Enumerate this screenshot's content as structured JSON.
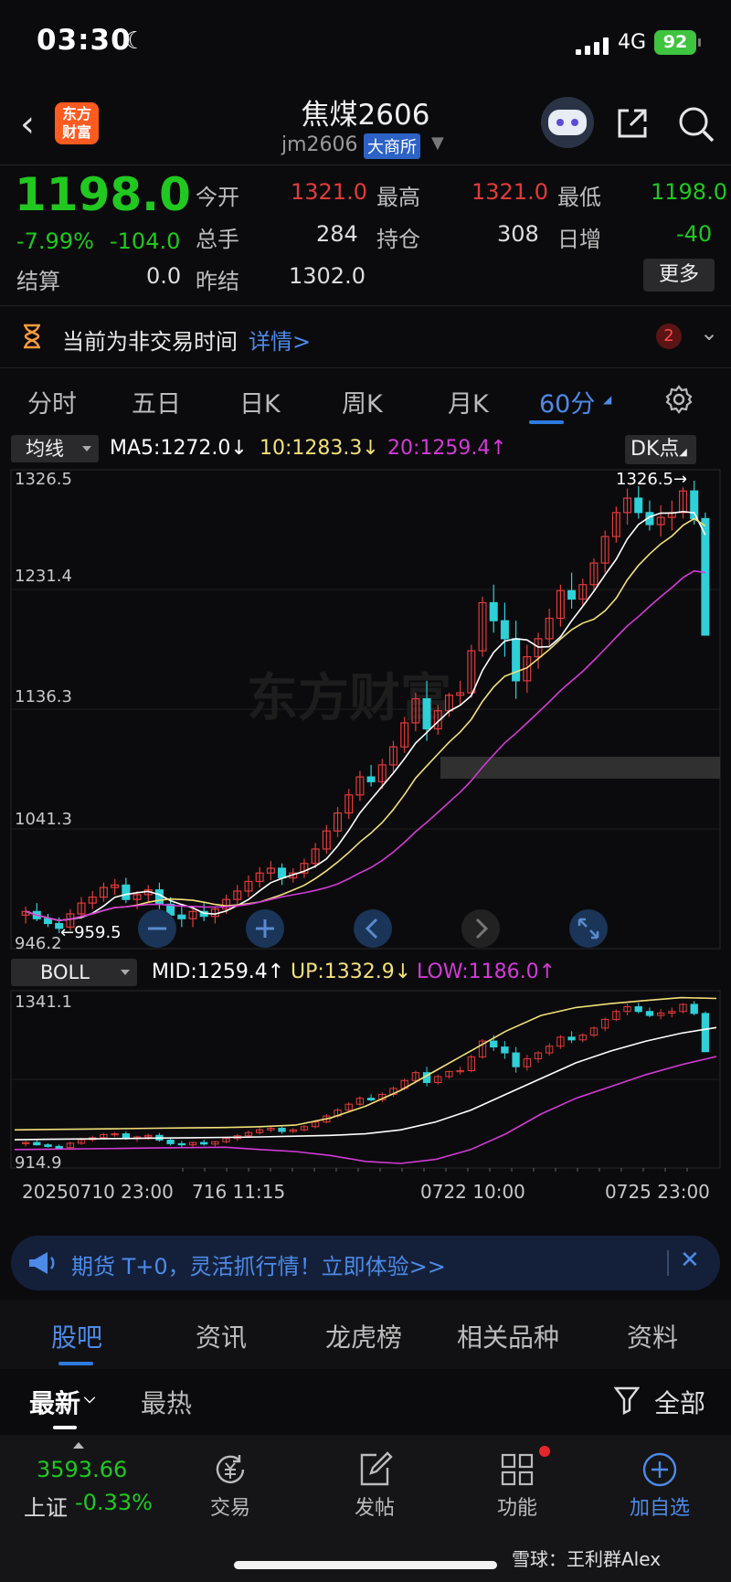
{
  "status_bar": {
    "time": "03:30",
    "moon": "☾",
    "network": "4G",
    "battery": "92"
  },
  "header": {
    "logo_text_1": "东方",
    "logo_text_2": "财富",
    "title": "焦煤2606",
    "code": "jm2606",
    "exchange": "大商所"
  },
  "quote": {
    "price": "1198.0",
    "change_pct": "-7.99%",
    "change_abs": "-104.0",
    "open_label": "今开",
    "open": "1321.0",
    "high_label": "最高",
    "high": "1321.0",
    "low_label": "最低",
    "low": "1198.0",
    "volume_label": "总手",
    "volume": "284",
    "oi_label": "持仓",
    "oi": "308",
    "daily_inc_label": "日增",
    "daily_inc": "-40",
    "settle_label": "结算",
    "settle": "0.0",
    "prev_settle_label": "昨结",
    "prev_settle": "1302.0",
    "more_label": "更多"
  },
  "notice": {
    "text": "当前为非交易时间",
    "link": "详情>",
    "badge": "2"
  },
  "period_tabs": [
    "分时",
    "五日",
    "日K",
    "周K",
    "月K",
    "60分"
  ],
  "period_active_caret": "◢",
  "main_chart": {
    "ma_selector": "均线",
    "ma5": "MA5:1272.0↓",
    "ma10": "10:1283.3↓",
    "ma20": "20:1259.4↑",
    "dk_button": "DK点",
    "dk_caret": "◢",
    "y_labels": [
      "1326.5",
      "1231.4",
      "1136.3",
      "1041.3",
      "946.2"
    ],
    "high_marker": "1326.5→",
    "low_marker": "←959.5",
    "watermark": "东方财富"
  },
  "boll_chart": {
    "selector": "BOLL",
    "mid": "MID:1259.4↑",
    "up": "UP:1332.9↓",
    "low": "LOW:1186.0↑",
    "y_labels": [
      "1341.1",
      "914.9"
    ]
  },
  "x_labels": [
    "20250710 23:00",
    "716 11:15",
    "0722 10:00",
    "0725 23:00"
  ],
  "colors": {
    "up": "#e23b3b",
    "down": "#2fd0d8",
    "ma5": "#ffffff",
    "ma10": "#f3e07a",
    "ma20": "#d23bd6",
    "accent": "#4d8ae8",
    "green": "#20c820"
  },
  "banner": {
    "text": "期货 T+0，灵活抓行情！立即体验>>"
  },
  "content_tabs": [
    "股吧",
    "资讯",
    "龙虎榜",
    "相关品种",
    "资料"
  ],
  "sort_tabs": {
    "latest": "最新",
    "hottest": "最热",
    "filter": "全部"
  },
  "bottom_bar": {
    "index_value": "3593.66",
    "index_name": "上证",
    "index_change": "-0.33%",
    "trade": "交易",
    "post": "发帖",
    "functions": "功能",
    "add_watch": "加自选"
  },
  "watermark": {
    "text": "雪球：王利群Alex"
  },
  "chart_data": [
    {
      "type": "candlestick",
      "title": "",
      "xlabel": "",
      "ylabel": "",
      "x": [
        "20250710 23:00",
        "716 11:15",
        "0722 10:00",
        "0725 23:00"
      ],
      "ylim": [
        946.2,
        1326.5
      ],
      "ohlc": [
        [
          965,
          972,
          958,
          968
        ],
        [
          968,
          975,
          960,
          962
        ],
        [
          962,
          966,
          955,
          958
        ],
        [
          958,
          963,
          950,
          954
        ],
        [
          955,
          970,
          952,
          966
        ],
        [
          966,
          980,
          962,
          975
        ],
        [
          975,
          985,
          970,
          980
        ],
        [
          980,
          992,
          976,
          988
        ],
        [
          988,
          995,
          982,
          990
        ],
        [
          990,
          996,
          975,
          978
        ],
        [
          978,
          985,
          970,
          982
        ],
        [
          982,
          990,
          975,
          986
        ],
        [
          986,
          992,
          970,
          974
        ],
        [
          974,
          980,
          960,
          965
        ],
        [
          965,
          972,
          955,
          962
        ],
        [
          962,
          970,
          955,
          968
        ],
        [
          968,
          975,
          960,
          964
        ],
        [
          964,
          972,
          958,
          970
        ],
        [
          970,
          982,
          966,
          978
        ],
        [
          978,
          990,
          972,
          985
        ],
        [
          985,
          998,
          980,
          993
        ],
        [
          993,
          1005,
          988,
          1000
        ],
        [
          1000,
          1010,
          994,
          1004
        ],
        [
          1004,
          1008,
          990,
          996
        ],
        [
          996,
          1004,
          992,
          1000
        ],
        [
          1000,
          1012,
          996,
          1008
        ],
        [
          1008,
          1025,
          1004,
          1020
        ],
        [
          1020,
          1040,
          1016,
          1035
        ],
        [
          1035,
          1055,
          1030,
          1050
        ],
        [
          1050,
          1070,
          1045,
          1065
        ],
        [
          1065,
          1085,
          1060,
          1080
        ],
        [
          1080,
          1090,
          1072,
          1076
        ],
        [
          1076,
          1095,
          1070,
          1090
        ],
        [
          1090,
          1110,
          1084,
          1105
        ],
        [
          1105,
          1130,
          1100,
          1125
        ],
        [
          1125,
          1150,
          1118,
          1145
        ],
        [
          1145,
          1160,
          1110,
          1120
        ],
        [
          1120,
          1140,
          1115,
          1135
        ],
        [
          1135,
          1150,
          1130,
          1148
        ],
        [
          1148,
          1160,
          1140,
          1150
        ],
        [
          1150,
          1190,
          1146,
          1185
        ],
        [
          1185,
          1230,
          1180,
          1225
        ],
        [
          1225,
          1240,
          1200,
          1210
        ],
        [
          1210,
          1225,
          1180,
          1195
        ],
        [
          1195,
          1210,
          1145,
          1160
        ],
        [
          1160,
          1190,
          1150,
          1180
        ],
        [
          1180,
          1200,
          1170,
          1195
        ],
        [
          1195,
          1220,
          1188,
          1212
        ],
        [
          1212,
          1240,
          1205,
          1235
        ],
        [
          1235,
          1250,
          1220,
          1228
        ],
        [
          1228,
          1245,
          1222,
          1240
        ],
        [
          1240,
          1262,
          1235,
          1258
        ],
        [
          1258,
          1285,
          1250,
          1280
        ],
        [
          1280,
          1305,
          1275,
          1300
        ],
        [
          1300,
          1320,
          1290,
          1312
        ],
        [
          1312,
          1322,
          1295,
          1300
        ],
        [
          1300,
          1310,
          1285,
          1290
        ],
        [
          1290,
          1306,
          1280,
          1296
        ],
        [
          1296,
          1310,
          1285,
          1300
        ],
        [
          1300,
          1321,
          1295,
          1318
        ],
        [
          1318,
          1326.5,
          1290,
          1295
        ],
        [
          1295,
          1300,
          1198,
          1198
        ]
      ],
      "ma": {
        "MA5": 1272.0,
        "MA10": 1283.3,
        "MA20": 1259.4
      },
      "high_marker": 1326.5,
      "low_marker": 959.5
    },
    {
      "type": "line",
      "title": "BOLL",
      "ylim": [
        914.9,
        1341.1
      ],
      "series": [
        {
          "name": "MID",
          "values": [
            975,
            976,
            977,
            978,
            979,
            980,
            981,
            982,
            984,
            986,
            990,
            1000,
            1020,
            1050,
            1090,
            1130,
            1170,
            1200,
            1225,
            1245,
            1259.4
          ]
        },
        {
          "name": "UP",
          "values": [
            1000,
            1001,
            1002,
            1003,
            1004,
            1005,
            1006,
            1008,
            1012,
            1030,
            1060,
            1100,
            1150,
            1200,
            1250,
            1290,
            1310,
            1320,
            1328,
            1335,
            1332.9
          ]
        },
        {
          "name": "LOW",
          "values": [
            950,
            951,
            952,
            953,
            954,
            955,
            956,
            950,
            945,
            935,
            920,
            915,
            925,
            950,
            990,
            1040,
            1080,
            1110,
            1140,
            1165,
            1186.0
          ]
        }
      ]
    }
  ]
}
